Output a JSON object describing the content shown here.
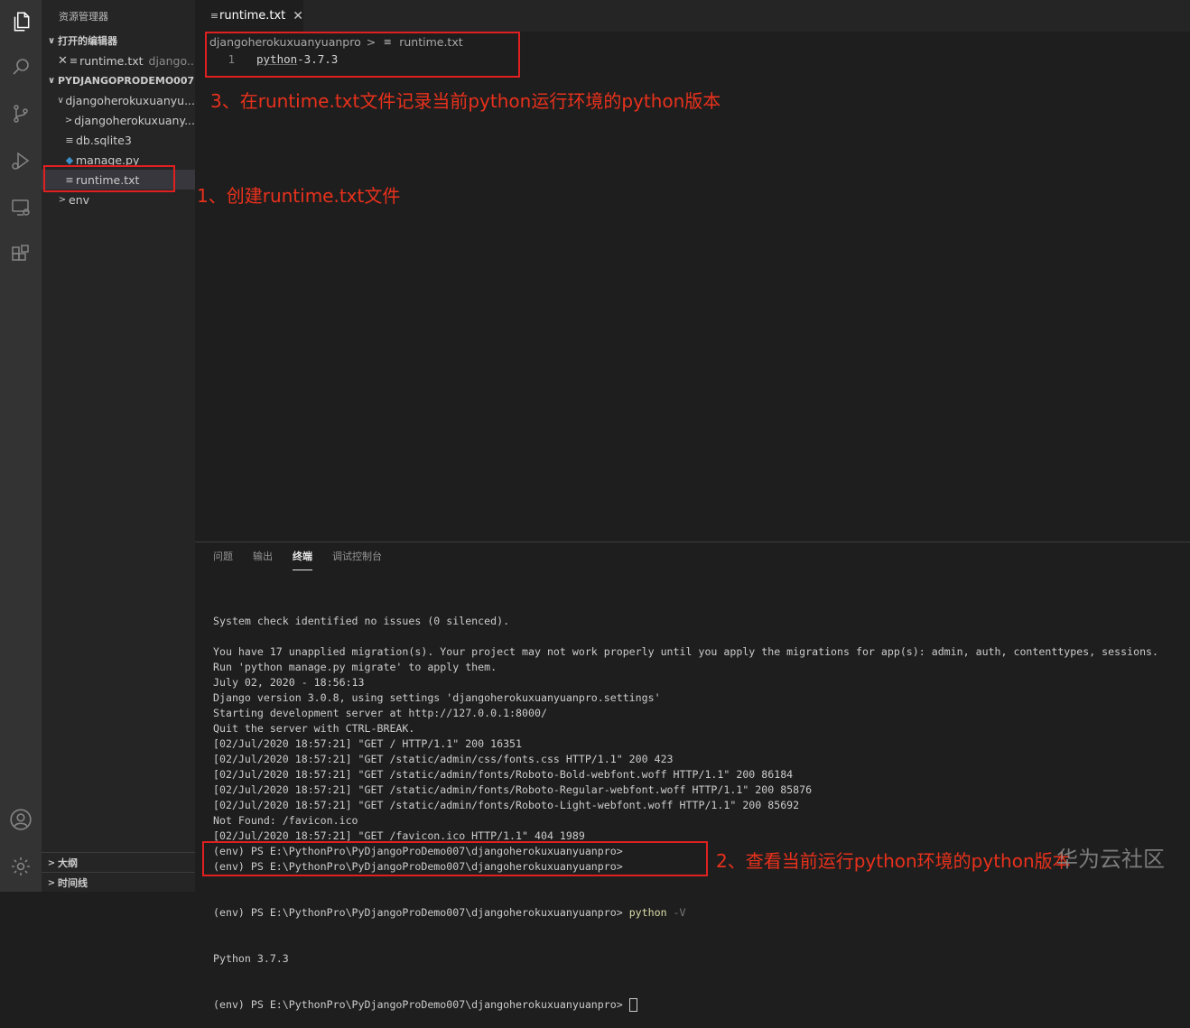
{
  "activity_bar": {
    "icons": [
      "files-icon",
      "search-icon",
      "source-control-icon",
      "run-debug-icon",
      "remote-explorer-icon",
      "extensions-icon"
    ],
    "bottom_icons": [
      "account-icon",
      "settings-gear-icon"
    ]
  },
  "sidebar": {
    "title": "资源管理器",
    "open_editors_header": "打开的编辑器",
    "open_editor_item": {
      "name": "runtime.txt",
      "path": "django..."
    },
    "project_header": "PYDJANGOPRODEMO007",
    "tree": [
      {
        "label": "djangoherokuxuanyu...",
        "type": "folder-open"
      },
      {
        "label": "djangoherokuxuany...",
        "type": "folder-closed"
      },
      {
        "label": "db.sqlite3",
        "type": "file"
      },
      {
        "label": "manage.py",
        "type": "python"
      },
      {
        "label": "runtime.txt",
        "type": "file"
      },
      {
        "label": "env",
        "type": "folder-closed"
      }
    ],
    "outline": "大纲",
    "timeline": "时间线"
  },
  "tab": {
    "label": "runtime.txt"
  },
  "breadcrumb": {
    "folder": "djangoherokuxuanyuanpro",
    "separator": ">",
    "file": "runtime.txt"
  },
  "editor": {
    "line_number": "1",
    "word": "python",
    "rest": "-3.7.3"
  },
  "panel": {
    "tabs": [
      "问题",
      "输出",
      "终端",
      "调试控制台"
    ],
    "active_tab": "终端"
  },
  "terminal": {
    "lines": [
      "System check identified no issues (0 silenced).",
      "",
      "You have 17 unapplied migration(s). Your project may not work properly until you apply the migrations for app(s): admin, auth, contenttypes, sessions.",
      "Run 'python manage.py migrate' to apply them.",
      "July 02, 2020 - 18:56:13",
      "Django version 3.0.8, using settings 'djangoherokuxuanyuanpro.settings'",
      "Starting development server at http://127.0.0.1:8000/",
      "Quit the server with CTRL-BREAK.",
      "[02/Jul/2020 18:57:21] \"GET / HTTP/1.1\" 200 16351",
      "[02/Jul/2020 18:57:21] \"GET /static/admin/css/fonts.css HTTP/1.1\" 200 423",
      "[02/Jul/2020 18:57:21] \"GET /static/admin/fonts/Roboto-Bold-webfont.woff HTTP/1.1\" 200 86184",
      "[02/Jul/2020 18:57:21] \"GET /static/admin/fonts/Roboto-Regular-webfont.woff HTTP/1.1\" 200 85876",
      "[02/Jul/2020 18:57:21] \"GET /static/admin/fonts/Roboto-Light-webfont.woff HTTP/1.1\" 200 85692",
      "Not Found: /favicon.ico",
      "[02/Jul/2020 18:57:21] \"GET /favicon.ico HTTP/1.1\" 404 1989",
      "(env) PS E:\\PythonPro\\PyDjangoProDemo007\\djangoherokuxuanyuanpro>",
      "(env) PS E:\\PythonPro\\PyDjangoProDemo007\\djangoherokuxuanyuanpro>"
    ],
    "prompt": "(env) PS E:\\PythonPro\\PyDjangoProDemo007\\djangoherokuxuanyuanpro> ",
    "command": "python",
    "flag": " -V",
    "version_output": "Python 3.7.3",
    "last_prompt": "(env) PS E:\\PythonPro\\PyDjangoProDemo007\\djangoherokuxuanyuanpro> "
  },
  "annotations": {
    "step1": "1、创建runtime.txt文件",
    "step2": "2、查看当前运行python环境的python版本",
    "step3": "3、在runtime.txt文件记录当前python运行环境的python版本",
    "color": "#e8311c"
  },
  "watermark": "华为云社区",
  "colors": {
    "activity_bar": "#333333",
    "sidebar": "#252526",
    "editor": "#1e1e1e",
    "highlight_box": "#e02020"
  }
}
